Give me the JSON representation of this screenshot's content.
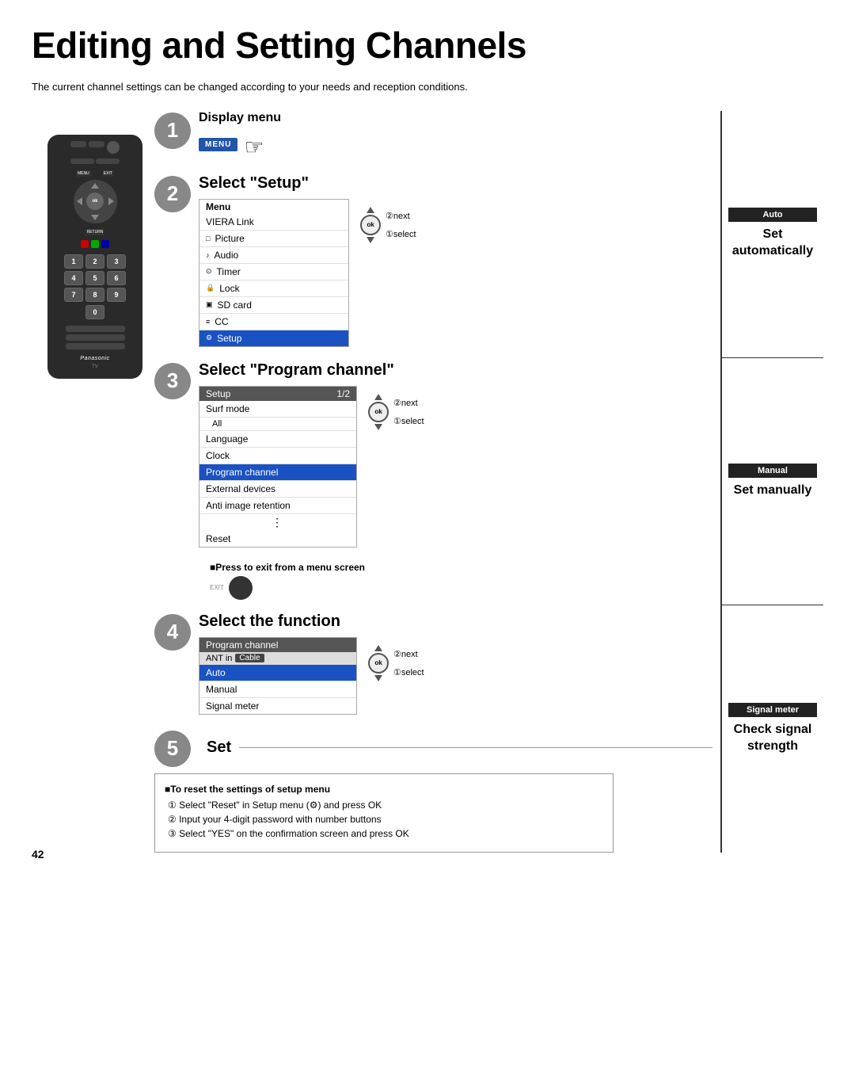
{
  "page": {
    "title": "Editing and Setting Channels",
    "intro": "The current channel settings can be changed according to your needs and reception conditions.",
    "page_number": "42"
  },
  "sidebar": {
    "sections": [
      {
        "badge": "Auto",
        "description": "Set automatically"
      },
      {
        "badge": "Manual",
        "description": "Set manually"
      },
      {
        "badge": "Signal meter",
        "description": "Check signal strength"
      }
    ]
  },
  "steps": [
    {
      "number": "1",
      "title": "Display menu",
      "menu_button": "MENU"
    },
    {
      "number": "2",
      "title": "Select \"Setup\"",
      "menu_items": [
        {
          "label": "Menu",
          "type": "header"
        },
        {
          "label": "VIERA Link",
          "type": "normal"
        },
        {
          "label": "Picture",
          "icon": "□",
          "type": "normal"
        },
        {
          "label": "Audio",
          "icon": "♪",
          "type": "normal"
        },
        {
          "label": "Timer",
          "icon": "⊙",
          "type": "normal"
        },
        {
          "label": "Lock",
          "icon": "🔒",
          "type": "normal"
        },
        {
          "label": "SD card",
          "icon": "▣",
          "type": "normal"
        },
        {
          "label": "CC",
          "icon": "≡",
          "type": "normal"
        },
        {
          "label": "Setup",
          "icon": "⚙",
          "type": "highlighted"
        }
      ],
      "nav_label_next": "②next",
      "nav_label_select": "①select"
    },
    {
      "number": "3",
      "title": "Select \"Program channel\"",
      "menu_header": "Setup",
      "menu_page": "1/2",
      "menu_items": [
        {
          "label": "Surf mode",
          "type": "normal"
        },
        {
          "label": "All",
          "type": "sub"
        },
        {
          "label": "Language",
          "type": "normal"
        },
        {
          "label": "Clock",
          "type": "normal"
        },
        {
          "label": "Program channel",
          "type": "highlighted"
        },
        {
          "label": "External devices",
          "type": "normal"
        },
        {
          "label": "Anti image retention",
          "type": "normal"
        },
        {
          "label": "Reset",
          "type": "last"
        }
      ],
      "nav_label_next": "②next",
      "nav_label_select": "①select"
    },
    {
      "number": "4",
      "title": "Select the function",
      "menu_header": "Program channel",
      "menu_sub_ant": "ANT in",
      "menu_sub_cable": "Cable",
      "menu_items": [
        {
          "label": "Auto",
          "type": "highlighted"
        },
        {
          "label": "Manual",
          "type": "normal"
        },
        {
          "label": "Signal meter",
          "type": "normal"
        }
      ],
      "nav_label_next": "②next",
      "nav_label_select": "①select"
    },
    {
      "number": "5",
      "title": "Set",
      "reset_section": {
        "title": "■To reset the settings of setup menu",
        "items": [
          "① Select \"Reset\" in Setup menu (⚙) and press OK",
          "② Input your 4-digit password with number buttons",
          "③ Select \"YES\" on the confirmation screen and press OK"
        ]
      }
    }
  ],
  "press_exit": {
    "text": "■Press to exit from a menu screen",
    "exit_label": "EXIT"
  },
  "remote": {
    "brand": "Panasonic",
    "type": "TV",
    "menu_label": "MENU",
    "exit_label": "EXIT",
    "ok_label": "ok",
    "return_label": "RETURN",
    "numbers": [
      "1",
      "2",
      "3",
      "4",
      "5",
      "6",
      "7",
      "8",
      "9",
      "0"
    ]
  }
}
